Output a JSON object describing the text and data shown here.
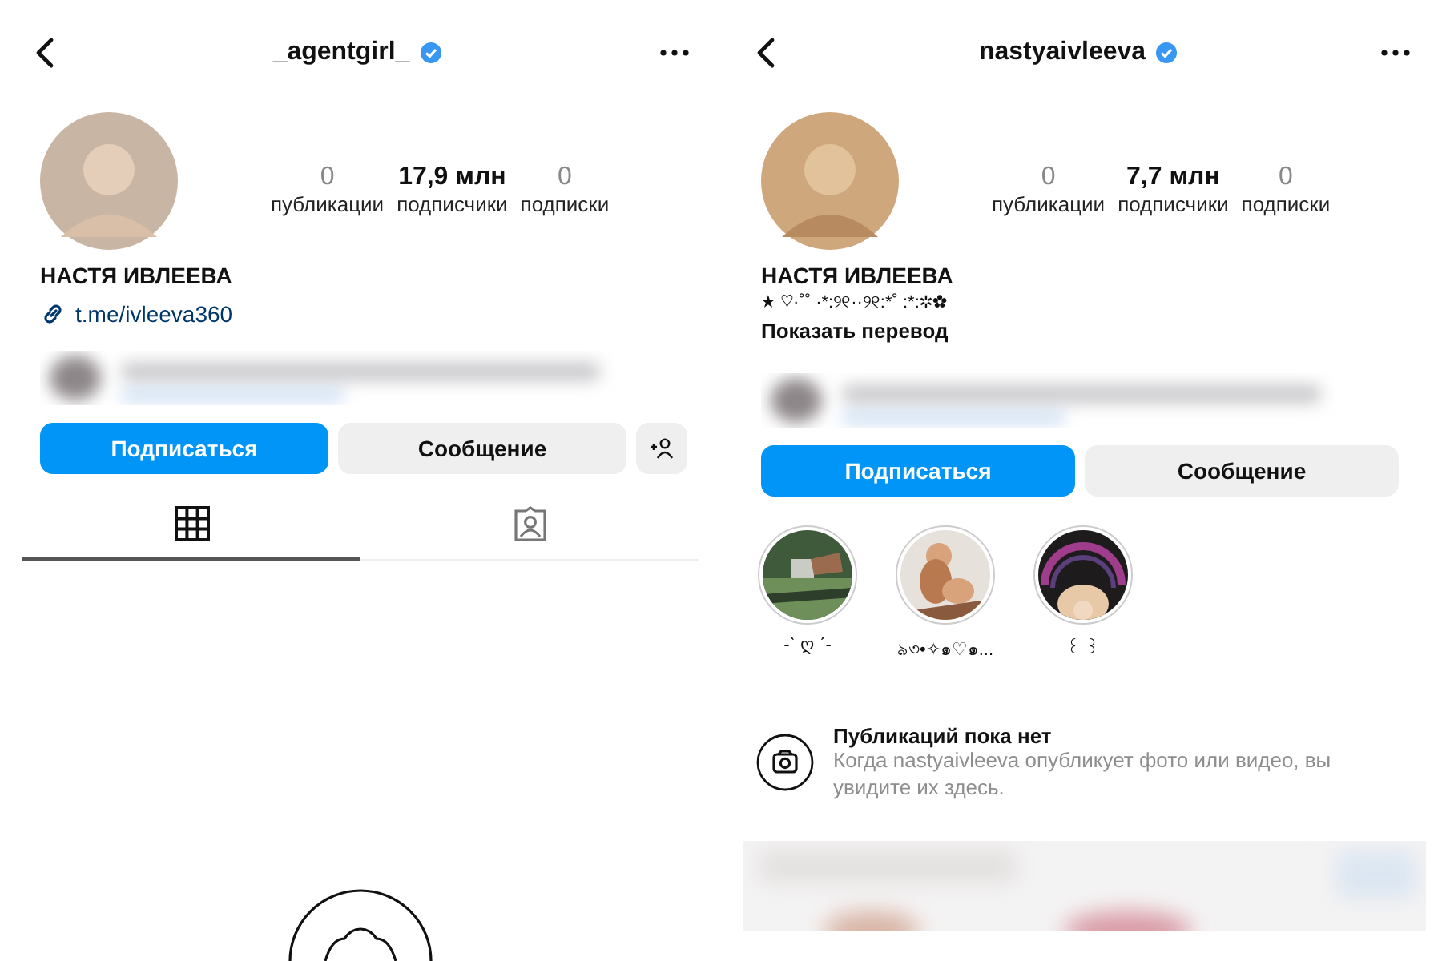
{
  "profiles": [
    {
      "username": "_agentgirl_",
      "verified": true,
      "stats": [
        {
          "count": "0",
          "label": "публикации",
          "bold": false
        },
        {
          "count": "17,9 млн",
          "label": "подписчики",
          "bold": true
        },
        {
          "count": "0",
          "label": "подписки",
          "bold": false
        }
      ],
      "name": "НАСТЯ ИВЛЕЕВА",
      "link": "t.me/ivleeva360",
      "buttons": {
        "follow": "Подписаться",
        "message": "Сообщение"
      },
      "suggest_button": true,
      "tabs": [
        {
          "kind": "grid",
          "selected": true
        },
        {
          "kind": "tagged",
          "selected": false
        }
      ]
    },
    {
      "username": "nastyaivleeva",
      "verified": true,
      "stats": [
        {
          "count": "0",
          "label": "публикации",
          "bold": false
        },
        {
          "count": "7,7 млн",
          "label": "подписчики",
          "bold": true
        },
        {
          "count": "0",
          "label": "подписки",
          "bold": false
        }
      ],
      "name": "НАСТЯ ИВЛЕЕВА",
      "bio": "★ ♡·˚˚ ·*:୨୧··୨୧:*˚ :*:✲✿",
      "translate": "Показать перевод",
      "buttons": {
        "follow": "Подписаться",
        "message": "Сообщение"
      },
      "stories": [
        {
          "label": "-ˋ ღ ˊ-"
        },
        {
          "label": "ঌ৩•✧๑♡๑..."
        },
        {
          "label": "꒰ ꒱"
        }
      ],
      "empty_state": {
        "title": "Публикаций пока нет",
        "text": "Когда nastyaivleeva опубликует фото или видео, вы увидите их здесь."
      }
    }
  ]
}
